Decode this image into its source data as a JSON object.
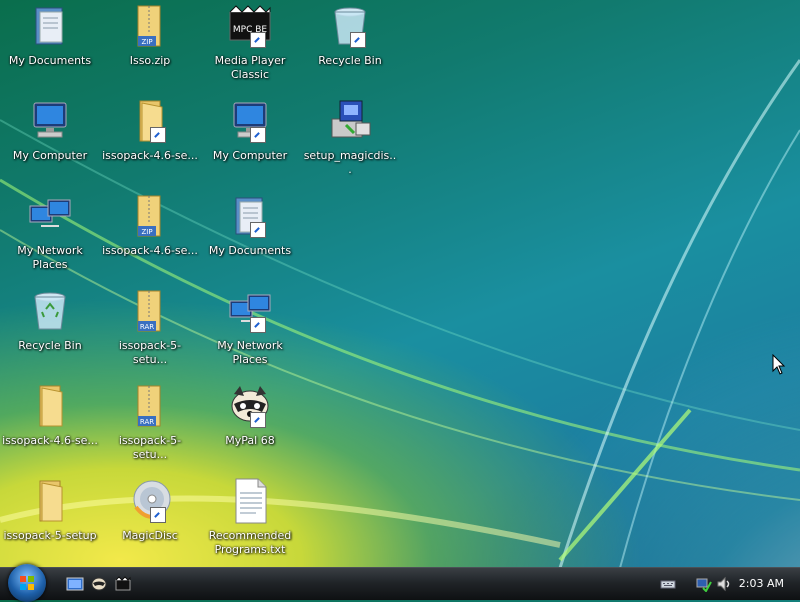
{
  "desktop": {
    "icons": [
      {
        "label": "My Documents",
        "icon": "documents-folder-icon"
      },
      {
        "label": "Isso.zip",
        "icon": "zip-folder-icon",
        "badge": "ZIP"
      },
      {
        "label": "Media Player Classic",
        "icon": "media-player-icon",
        "badge": "MPC BE"
      },
      {
        "label": "Recycle Bin",
        "icon": "recycle-bin-icon"
      },
      {
        "label": "My Computer",
        "icon": "computer-icon"
      },
      {
        "label": "issopack-4.6-se...",
        "icon": "folder-icon"
      },
      {
        "label": "My Computer",
        "icon": "computer-icon"
      },
      {
        "label": "setup_magicdis...",
        "icon": "installer-icon"
      },
      {
        "label": "My Network Places",
        "icon": "network-icon"
      },
      {
        "label": "issopack-4.6-se...",
        "icon": "zip-folder-icon",
        "badge": "ZIP"
      },
      {
        "label": "My Documents",
        "icon": "documents-folder-icon"
      },
      {
        "label": "Recycle Bin",
        "icon": "recycle-bin-icon"
      },
      {
        "label": "issopack-5-setu...",
        "icon": "rar-archive-icon",
        "badge": "RAR"
      },
      {
        "label": "My Network Places",
        "icon": "network-icon"
      },
      {
        "label": "issopack-4.6-se...",
        "icon": "folder-icon"
      },
      {
        "label": "issopack-5-setu...",
        "icon": "rar-archive-icon",
        "badge": "RAR"
      },
      {
        "label": "MyPal 68",
        "icon": "raccoon-icon"
      },
      {
        "label": "issopack-5-setup",
        "icon": "folder-icon"
      },
      {
        "label": "MagicDisc",
        "icon": "disc-icon"
      },
      {
        "label": "Recommended Programs.txt",
        "icon": "text-file-icon"
      }
    ]
  },
  "taskbar": {
    "start_button": "start-orb-icon",
    "quick_launch": [
      "show-desktop-icon",
      "mypal-icon",
      "media-player-icon"
    ],
    "tray_icons": [
      "keyboard-icon",
      "network-status-icon",
      "volume-icon"
    ],
    "clock": "2:03 AM"
  },
  "colors": {
    "taskbar": "#202428",
    "accent": "#1d5fa8"
  }
}
